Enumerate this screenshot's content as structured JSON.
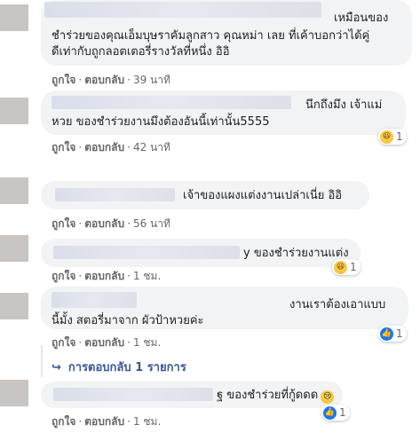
{
  "comments": [
    {
      "lines": [
        "เหมือนของ",
        "ชำร่วยของคุณเอ็มบุษรา​คัม​ลูกสาว คุณหม่า เลย ที่เค้าบอกว่าได้คู่",
        "ดี​เท่ากับถูกลอตเตอรี่รางวัลที่หนึ่ง อิอิ"
      ],
      "like": "ถูกใจ",
      "reply": "ตอบกลับ",
      "time": "39 นาที"
    },
    {
      "lines": [
        "นึกถึงมึง เจ้าแม่",
        "หวย ของชำร่วยงานมึงต้องอันนี้เท่านั้น5555"
      ],
      "like": "ถูกใจ",
      "reply": "ตอบกลับ",
      "time": "42 นาที",
      "reaction": {
        "icon": "haha-icon",
        "count": "1"
      }
    },
    {
      "lines": [
        "เจ้าของแผงแต่งงานเปล่าเนี่ย อิอิ"
      ],
      "like": "ถูกใจ",
      "reply": "ตอบกลับ",
      "time": "56 นาที"
    },
    {
      "lines": [
        "y ของชำร่วยงานแต่ง"
      ],
      "like": "ถูกใจ",
      "reply": "ตอบกลับ",
      "time": "1 ชม.",
      "reaction": {
        "icon": "haha-icon",
        "count": "1"
      }
    },
    {
      "lines": [
        "งานเราต้องเอาแบบ",
        "นี้มั้ง สตอรี่มาจาก ผัวป้าหวยค่ะ"
      ],
      "like": "ถูกใจ",
      "reply": "ตอบกลับ",
      "time": "1 ชม.",
      "reaction": {
        "icon": "like-icon",
        "count": "1"
      }
    },
    {
      "lines": [
        "ฐ ของชำร่วยที่กู้ดดด"
      ],
      "emoji": "😢",
      "like": "ถูกใจ",
      "reply": "ตอบกลับ",
      "time": "1 ชม.",
      "reaction": {
        "icon": "like-icon",
        "count": "1"
      }
    }
  ],
  "view_replies": "การตอบกลับ 1 รายการ",
  "colors": {
    "link": "#385898",
    "bubble": "#f2f3f5",
    "meta": "#65676b",
    "like_blue": "#1877f2"
  }
}
